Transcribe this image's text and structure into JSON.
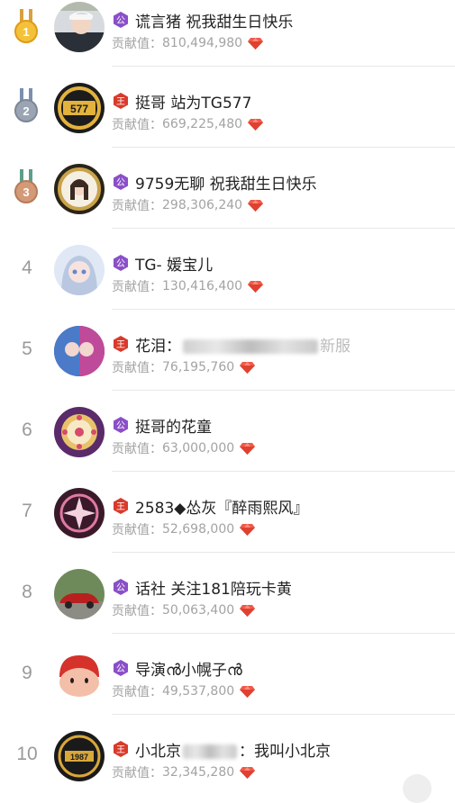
{
  "contribution_label": "贡献值：",
  "rankings": [
    {
      "rank": "1",
      "badge": "公",
      "badge_color": "#8a4fc8",
      "name": "谎言猪 祝我甜生日快乐",
      "value": "810,494,980",
      "avatar_icon": "boy-photo-avatar"
    },
    {
      "rank": "2",
      "badge": "王",
      "badge_color": "#d93a2b",
      "name": "挺哥 站为TG577",
      "value": "669,225,480",
      "avatar_icon": "tg577-logo-avatar"
    },
    {
      "rank": "3",
      "badge": "公",
      "badge_color": "#8a4fc8",
      "name": "9759无聊 祝我甜生日快乐",
      "value": "298,306,240",
      "avatar_icon": "anime-girl-avatar"
    },
    {
      "rank": "4",
      "badge": "公",
      "badge_color": "#8a4fc8",
      "name": "TG- 媛宝儿",
      "value": "130,416,400",
      "avatar_icon": "doll-girl-avatar"
    },
    {
      "rank": "5",
      "badge": "王",
      "badge_color": "#d93a2b",
      "name_prefix": "花泪：",
      "name_suffix": "新服",
      "value": "76,195,760",
      "avatar_icon": "anime-couple-avatar"
    },
    {
      "rank": "6",
      "badge": "公",
      "badge_color": "#8a4fc8",
      "name": "挺哥的花童",
      "value": "63,000,000",
      "avatar_icon": "flower-ring-avatar"
    },
    {
      "rank": "7",
      "badge": "王",
      "badge_color": "#d93a2b",
      "name": "2583◆怂灰『醉雨熙风』",
      "value": "52,698,000",
      "avatar_icon": "emblem-avatar"
    },
    {
      "rank": "8",
      "badge": "公",
      "badge_color": "#8a4fc8",
      "name": "话社 关注181陪玩卡黄",
      "value": "50,063,400",
      "avatar_icon": "red-car-avatar"
    },
    {
      "rank": "9",
      "badge": "公",
      "badge_color": "#8a4fc8",
      "name": "导演ൻ小幌子ൻ",
      "value": "49,537,800",
      "avatar_icon": "cartoon-face-avatar"
    },
    {
      "rank": "10",
      "badge": "王",
      "badge_color": "#d93a2b",
      "name_prefix": "小北京",
      "name_suffix": "：我叫小北京",
      "value": "32,345,280",
      "avatar_icon": "jingwang-1987-avatar"
    }
  ],
  "colors": {
    "gold": "#f0b72f",
    "silver": "#8c97a6",
    "bronze": "#c98d6b",
    "gem": "#f05a4a"
  }
}
